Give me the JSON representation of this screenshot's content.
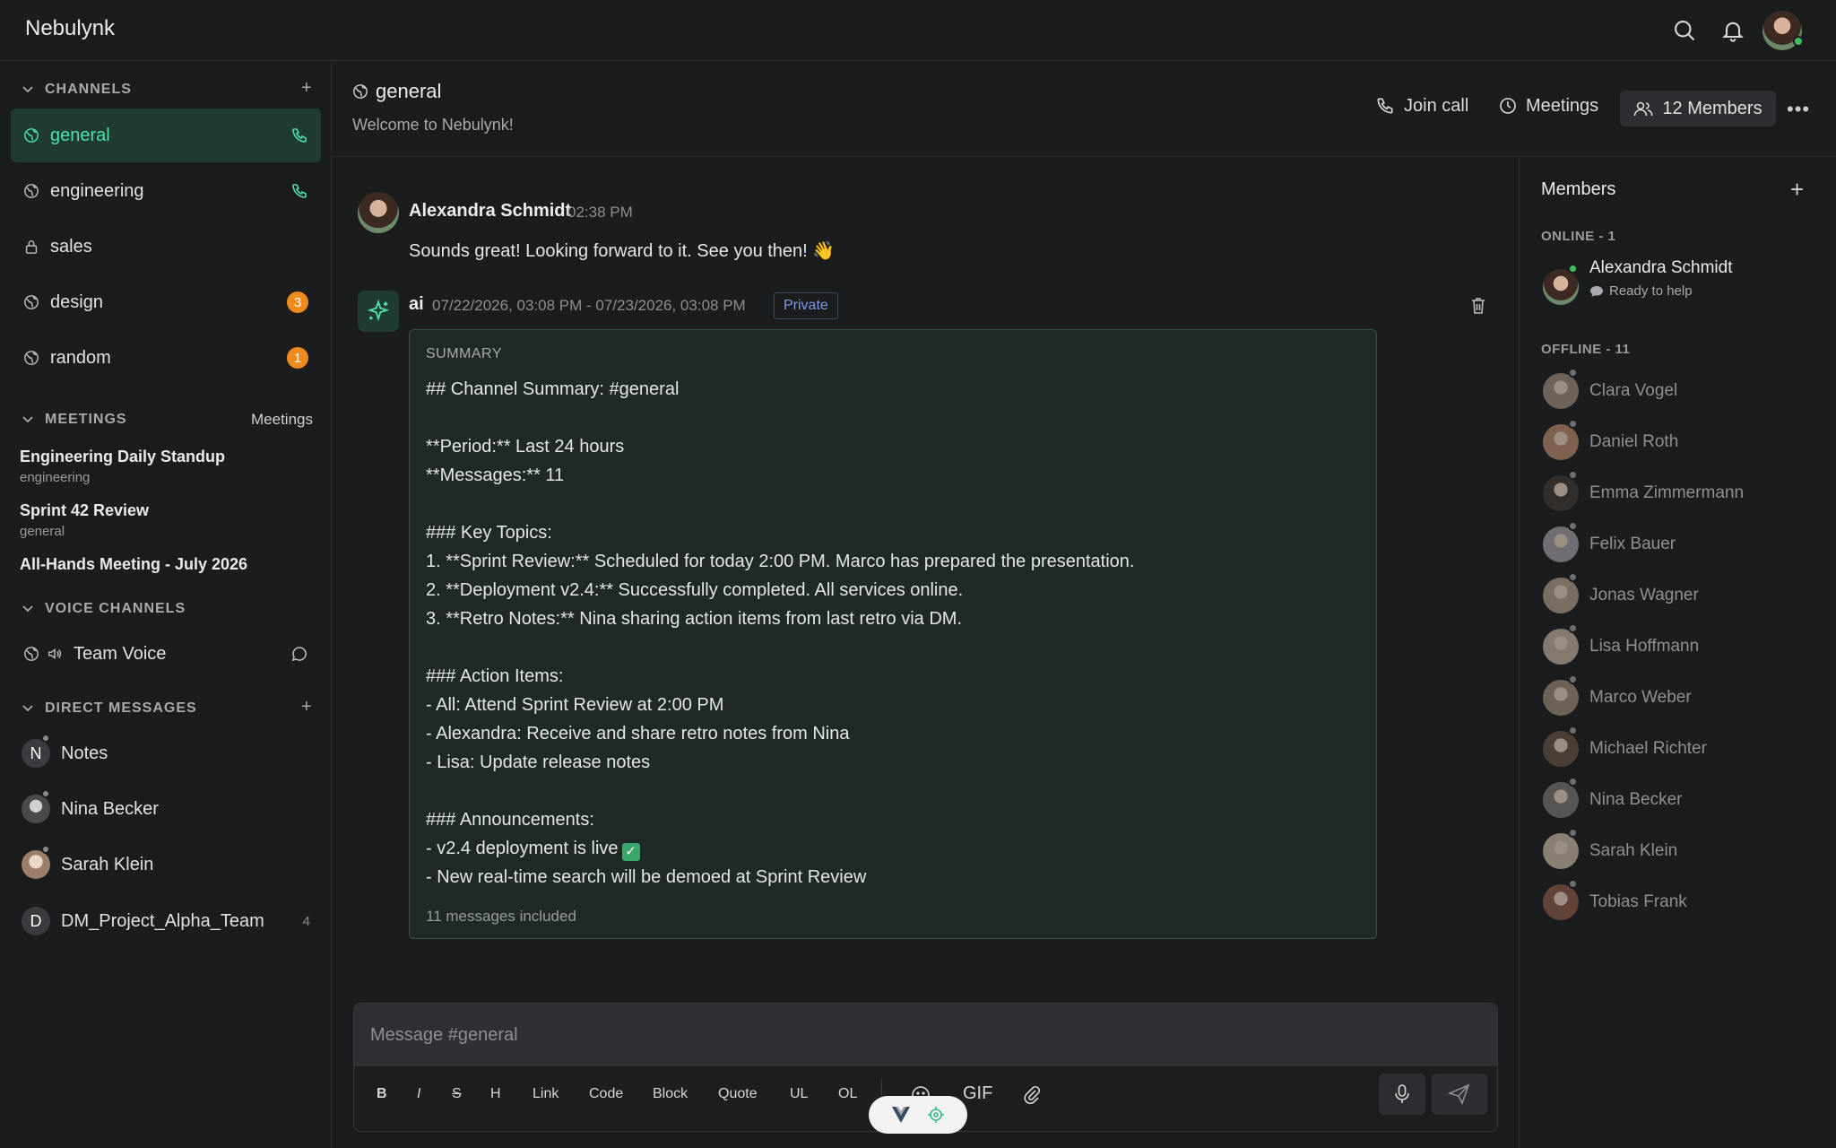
{
  "app": {
    "brand": "Nebulynk"
  },
  "sidebar": {
    "channels_label": "CHANNELS",
    "channels": [
      {
        "name": "general",
        "icon": "globe-icon",
        "active": true,
        "call": true
      },
      {
        "name": "engineering",
        "icon": "globe-icon",
        "call": true
      },
      {
        "name": "sales",
        "icon": "lock-icon"
      },
      {
        "name": "design",
        "icon": "globe-icon",
        "badge": "3"
      },
      {
        "name": "random",
        "icon": "globe-icon",
        "badge": "1"
      }
    ],
    "meetings_label": "MEETINGS",
    "meetings_link": "Meetings",
    "meetings": [
      {
        "title": "Engineering Daily Standup",
        "channel": "engineering"
      },
      {
        "title": "Sprint 42 Review",
        "channel": "general"
      },
      {
        "title": "All-Hands Meeting - July 2026",
        "channel": ""
      }
    ],
    "voice_label": "VOICE CHANNELS",
    "voice": [
      {
        "name": "Team Voice"
      }
    ],
    "dm_label": "DIRECT MESSAGES",
    "dms": [
      {
        "name": "Notes",
        "initial": "N",
        "color": "#3a3b3e"
      },
      {
        "name": "Nina Becker",
        "initial": "",
        "color": "#6b6c70"
      },
      {
        "name": "Sarah Klein",
        "initial": "",
        "color": "#b9a89a"
      },
      {
        "name": "DM_Project_Alpha_Team",
        "initial": "D",
        "color": "#3a3b3e",
        "count": "4"
      }
    ]
  },
  "channel": {
    "title": "general",
    "subtitle": "Welcome to Nebulynk!",
    "join_call": "Join call",
    "meetings": "Meetings",
    "members": "12 Members"
  },
  "messages": [
    {
      "author": "Alexandra Schmidt",
      "time": "02:38 PM",
      "text": "Sounds great! Looking forward to it. See you then! 👋"
    },
    {
      "author": "ai",
      "time": "07/22/2026, 03:08 PM - 07/23/2026, 03:08 PM",
      "tag": "Private",
      "summary_label": "SUMMARY",
      "summary_lines": [
        "## Channel Summary: #general",
        "",
        "**Period:** Last 24 hours",
        "**Messages:** 11",
        "",
        "### Key Topics:",
        "1. **Sprint Review:** Scheduled for today 2:00 PM. Marco has prepared the presentation.",
        "2. **Deployment v2.4:** Successfully completed. All services online.",
        "3. **Retro Notes:** Nina sharing action items from last retro via DM.",
        "",
        "### Action Items:",
        "- All: Attend Sprint Review at 2:00 PM",
        "- Alexandra: Receive and share retro notes from Nina",
        "- Lisa: Update release notes",
        "",
        "### Announcements:",
        "- v2.4 deployment is live",
        "- New real-time search will be demoed at Sprint Review"
      ],
      "summary_footer": "11 messages included"
    }
  ],
  "members_panel": {
    "title": "Members",
    "online_label": "ONLINE - 1",
    "online": [
      {
        "name": "Alexandra Schmidt",
        "status": "Ready to help"
      }
    ],
    "offline_label": "OFFLINE - 11",
    "offline": [
      "Clara Vogel",
      "Daniel Roth",
      "Emma Zimmermann",
      "Felix Bauer",
      "Jonas Wagner",
      "Lisa Hoffmann",
      "Marco Weber",
      "Michael Richter",
      "Nina Becker",
      "Sarah Klein",
      "Tobias Frank"
    ]
  },
  "composer": {
    "placeholder": "Message #general",
    "tools": [
      "B",
      "I",
      "S",
      "H",
      "Link",
      "Code",
      "Block",
      "Quote",
      "UL",
      "OL"
    ],
    "gif": "GIF"
  },
  "colors": {
    "accent": "#4fe0a8",
    "badge": "#f08c1c",
    "online": "#3fbf5f",
    "private": "#7c9be8"
  }
}
